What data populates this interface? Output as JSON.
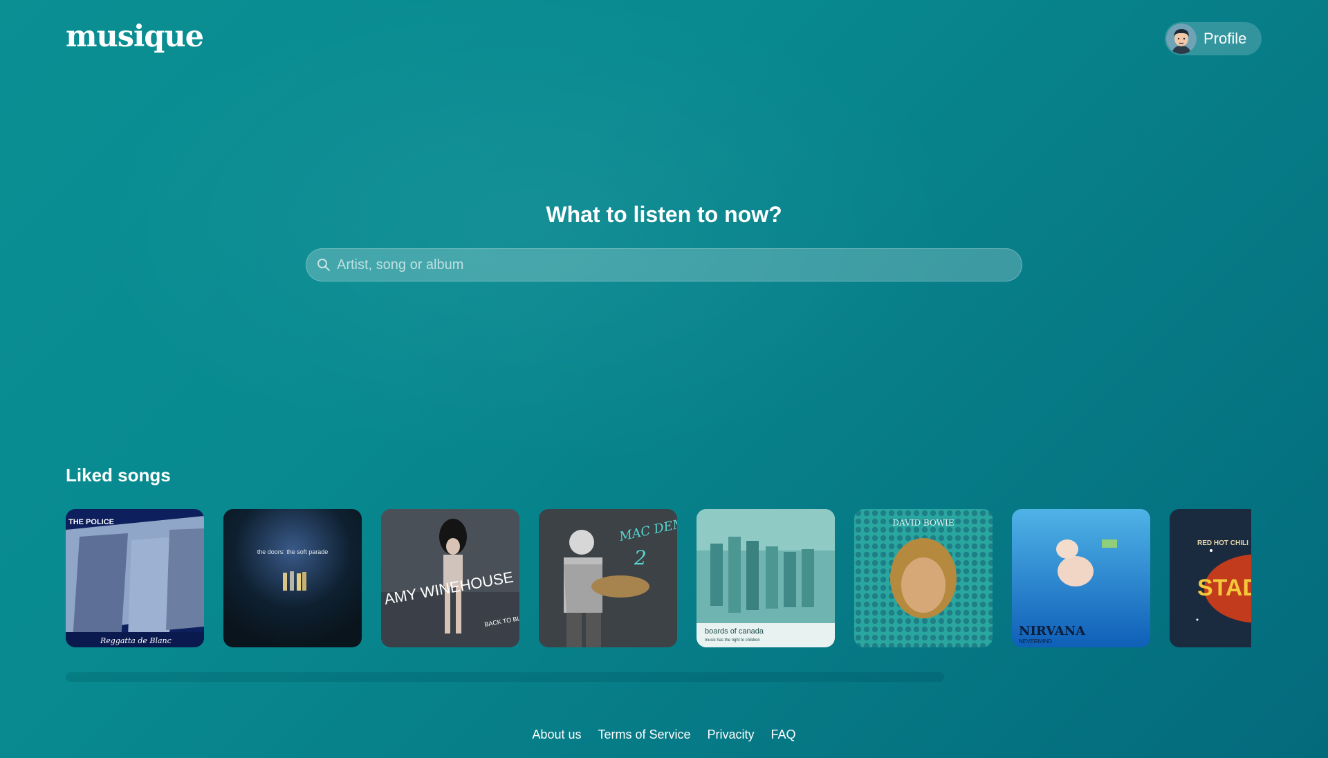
{
  "app": {
    "logo": "musique"
  },
  "header": {
    "profile_label": "Profile"
  },
  "hero": {
    "title": "What to listen to now?",
    "search_placeholder": "Artist, song or album"
  },
  "liked": {
    "title": "Liked songs",
    "albums": [
      {
        "name": "police-reggatta-de-blanc",
        "cover_title": "THE POLICE",
        "cover_sub": "Reggatta de Blanc"
      },
      {
        "name": "doors-soft-parade",
        "cover_title": "the doors: the soft parade"
      },
      {
        "name": "amy-winehouse-back-to-black",
        "cover_title": "AMY WINEHOUSE",
        "cover_sub": "BACK TO BLACK"
      },
      {
        "name": "mac-demarco-2",
        "cover_title": "MAC DEMARCO",
        "cover_sub": "2"
      },
      {
        "name": "boards-of-canada",
        "cover_title": "boards of canada",
        "cover_sub": "music has the right to children"
      },
      {
        "name": "david-bowie",
        "cover_title": "DAVID BOWIE"
      },
      {
        "name": "nirvana-nevermind",
        "cover_title": "NIRVANA",
        "cover_sub": "NEVERMIND"
      },
      {
        "name": "rhcp-stadium-arcadium",
        "cover_title": "RED HOT CHILI",
        "cover_sub": "STAD ARCA"
      }
    ]
  },
  "footer": {
    "links": [
      "About us",
      "Terms of Service",
      "Privacity",
      "FAQ"
    ]
  },
  "colors": {
    "bg_start": "#0b8f93",
    "bg_end": "#036a7c",
    "text": "#ffffff"
  }
}
